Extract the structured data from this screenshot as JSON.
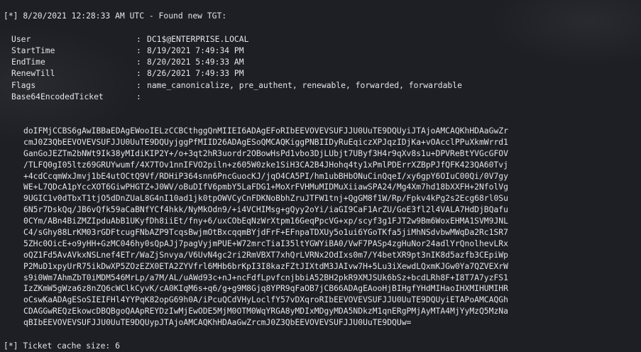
{
  "header_line": "[*] 8/20/2021 12:28:33 AM UTC - Found new TGT:",
  "fields": [
    {
      "key": "User",
      "value": "DC1$@ENTERPRISE.LOCAL"
    },
    {
      "key": "StartTime",
      "value": "8/19/2021 7:49:34 PM"
    },
    {
      "key": "EndTime",
      "value": "8/20/2021 5:49:33 AM"
    },
    {
      "key": "RenewTill",
      "value": "8/26/2021 7:49:33 PM"
    },
    {
      "key": "Flags",
      "value": "name_canonicalize, pre_authent, renewable, forwarded, forwardable"
    },
    {
      "key": "Base64EncodedTicket",
      "value": ""
    }
  ],
  "separator": ":",
  "ticket_lines": [
    "doIFMjCCBS6gAwIBBaEDAgEWooIELzCCBCthggQnMIIEI6ADAgEFoRIbEEVOVEVSUFJJU0UuTE9DQUyiJTAjoAMCAQKhHDAaGwZr",
    "cmJ0Z3QbEEVOVEVSUFJJU0UuTE9DQUyjggPfMIID26ADAgESoQMCAQKiggPNBIIDyRuEqiczXPJqzIDjKa+vOAcclPPuXkmWrrd1",
    "GanGoJEZTm2bNWt9Ik38yMIdiKIP2Y+/o+3qt2hR3uordr2OBowHsPd1vbo3DjLUbjt7UByf3H4r9qXv8s1u+DPVReBtYVGcGFOV",
    "/TLFQ0gI05ltz69GRUYwumf/4X7TOv1nnIFVO2piln+z605W0zke1SiH3CA2B4JHohq4ty1xPmlPDErrXZBpPJfQFK423QA60Tvj",
    "+4cdCcqmWxJmvj1bE4utOCtQ9Vf/RDHiP364snn6PncGuocKJ/jqO4CA5PI/hm1ubBHbONuCinQqeI/xy6gpY6OIuC00Qi/0V7gy",
    "WE+L7QDcA1pYccXOT6GiwPHGTZ+J0WV/oBuDIfV6pmbY5LaFDG1+MoXrFVHMuMIDMuXiiawSPA24/Mg4Xm7hd18bXXFH+2NfolVg",
    "9UGIC1v0dTbxT1tjO5dDnZUaL8G4nI10ad1jk0tpOWVCyCnFDKNoBbhZruJTFW1tnj+QgGM8f1W/Rp/Fpkv4kPg2s2Ecg68rl0Su",
    "6N5r7DskQq/JB6vQfk59aCaBNfYCf4hkk/NyMkOdn9/+i4VCHIMsg+gQyy2oYi/iaGI9CaF1ArZU/GoE3fl2l4VALA7HdDjBQafu",
    "0CYm/ABn4BiZMZIpduAbB1UKyfDh8iiEt/fny+6/uxCObEqNzWrXtpm16GeqPpcVG+xp/scyf3g1FJT2w9Bm6WoxEHMA1SVM9JNL",
    "C4/sGhy88LrKM03rGDFtcugFNbAZP9TcqsBwjmOtBxcqqmBYjdFrF+EFnpaTDXUy5o1ui6YGoTKfa5jiMhNSdvbwMWqDa2Rc1SR7",
    "5ZHc0OicE+o9yHH+GzMC046hy0sQpAJj7pagVyjmPUE+W72mrcTiaI35ltYGWYiBA0/VwF7PASp4zgHuNor24adlYrQnolhevLRx",
    "oQZ1Fd5AvAVkxNSLnef4ETr/WaZjSnvya/V6UvN4gc2ri2RmVBXT7xhQrLVRNx2OdIxs0m7/Y4betXR9pt3nIK8d5azfb3CEpiWp",
    "P2MuD1xpyUrR75ikDwXP5ZOzEZX0ETA2ZYVfrl6MHb6brKpI3I8kazFZtJIXtdM3JAIvw7H+5Lu3iXewdLQxmKJGw0Ya7QZVEXrW",
    "s9i0Wm7AhmZbT0iMDM546MrLp/a7M/AL/uAWd93c+nJ+ncFdfLpvfcnjbbiA52BH2pkR9XMJSUk6bSz+bcdLRh8F+I8T7A7yzFS1",
    "IzZKmW5gWza6z8nZQ6cWClkCyvK/cA0KIqM6s+q6/g+g9M8Gjq8YPR9qFaOB7jCB66ADAgEAooHjBIHgfYHdMIHaoIHXMIHUMIHR",
    "oCswKaADAgESoSIEIFHl4YYPqK82opG69h0A/iPcuQCdVHyLoclfY57vDXqroRIbEEVOVEVSUFJJU0UuTE9DQUyiETAPoAMCAQGh",
    "CDAGGwREQzEkowcDBQBgoQAApREYDzIwMjEwODE5MjM0OTM0WqYRGA8yMDIxMDgyMDA5NDkzM1qnERgPMjAyMTA4MjYyMzQ5MzNa",
    "qBIbEEVOVEVSUFJJU0UuTE9DQUypJTAjoAMCAQKhHDAaGwZrcmJ0Z3QbEEVOVEVSUFJJU0UuTE9DQUw="
  ],
  "footer_line": "[*] Ticket cache size: 6"
}
